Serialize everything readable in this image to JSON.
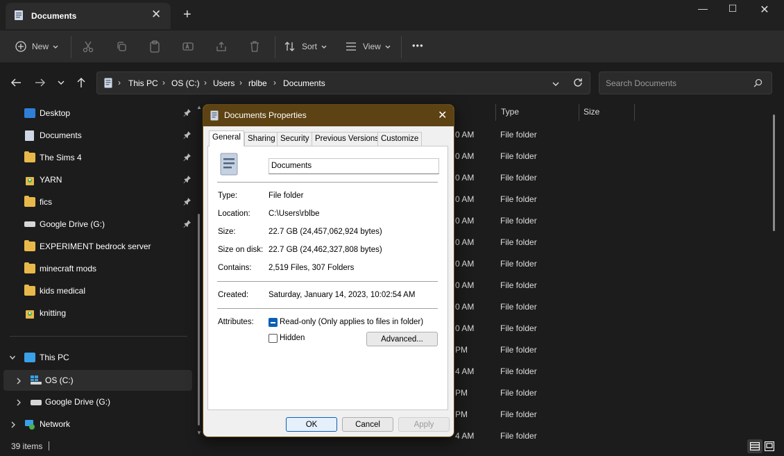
{
  "window": {
    "tab_title": "Documents",
    "tab_close": "✕",
    "new_tab": "+",
    "minimize": "—",
    "maximize": "☐",
    "close": "✕"
  },
  "toolbar": {
    "new_label": "New",
    "sort_label": "Sort",
    "view_label": "View",
    "more": "•••"
  },
  "address": {
    "crumbs": [
      "This PC",
      "OS (C:)",
      "Users",
      "rblbe",
      "Documents"
    ],
    "search_placeholder": "Search Documents"
  },
  "sidebar": {
    "quick": [
      {
        "label": "Desktop",
        "icon": "desktop-icon"
      },
      {
        "label": "Documents",
        "icon": "documents-icon"
      },
      {
        "label": "The Sims 4",
        "icon": "folder-icon"
      },
      {
        "label": "YARN",
        "icon": "shared-folder-icon"
      },
      {
        "label": "fics",
        "icon": "folder-icon"
      },
      {
        "label": "Google Drive (G:)",
        "icon": "drive-icon"
      },
      {
        "label": "EXPERIMENT bedrock server",
        "icon": "folder-icon"
      },
      {
        "label": "minecraft mods",
        "icon": "folder-icon"
      },
      {
        "label": "kids medical",
        "icon": "folder-icon"
      },
      {
        "label": "knitting",
        "icon": "shared-folder-icon"
      }
    ],
    "this_pc": "This PC",
    "os_c": "OS (C:)",
    "gdrive": "Google Drive (G:)",
    "network": "Network"
  },
  "filepane": {
    "col_type": "Type",
    "col_size": "Size",
    "rows": [
      {
        "date": "0 AM",
        "type": "File folder"
      },
      {
        "date": "0 AM",
        "type": "File folder"
      },
      {
        "date": "0 AM",
        "type": "File folder"
      },
      {
        "date": "0 AM",
        "type": "File folder"
      },
      {
        "date": "0 AM",
        "type": "File folder"
      },
      {
        "date": "0 AM",
        "type": "File folder"
      },
      {
        "date": "0 AM",
        "type": "File folder"
      },
      {
        "date": "0 AM",
        "type": "File folder"
      },
      {
        "date": "0 AM",
        "type": "File folder"
      },
      {
        "date": "0 AM",
        "type": "File folder"
      },
      {
        "date": "PM",
        "type": "File folder"
      },
      {
        "date": "4 AM",
        "type": "File folder"
      },
      {
        "date": "PM",
        "type": "File folder"
      },
      {
        "date": "PM",
        "type": "File folder"
      },
      {
        "date": "4 AM",
        "type": "File folder"
      }
    ]
  },
  "status": {
    "items": "39 items"
  },
  "dialog": {
    "title": "Documents Properties",
    "tabs": [
      "General",
      "Sharing",
      "Security",
      "Previous Versions",
      "Customize"
    ],
    "name_value": "Documents",
    "type_k": "Type:",
    "type_v": "File folder",
    "location_k": "Location:",
    "location_v": "C:\\Users\\rblbe",
    "size_k": "Size:",
    "size_v": "22.7 GB (24,457,062,924 bytes)",
    "disk_k": "Size on disk:",
    "disk_v": "22.7 GB (24,462,327,808 bytes)",
    "contains_k": "Contains:",
    "contains_v": "2,519 Files, 307 Folders",
    "created_k": "Created:",
    "created_v": "Saturday, January 14, 2023, 10:02:54 AM",
    "attributes_k": "Attributes:",
    "readonly_label": "Read-only (Only applies to files in folder)",
    "hidden_label": "Hidden",
    "advanced_label": "Advanced...",
    "ok_label": "OK",
    "cancel_label": "Cancel",
    "apply_label": "Apply"
  }
}
